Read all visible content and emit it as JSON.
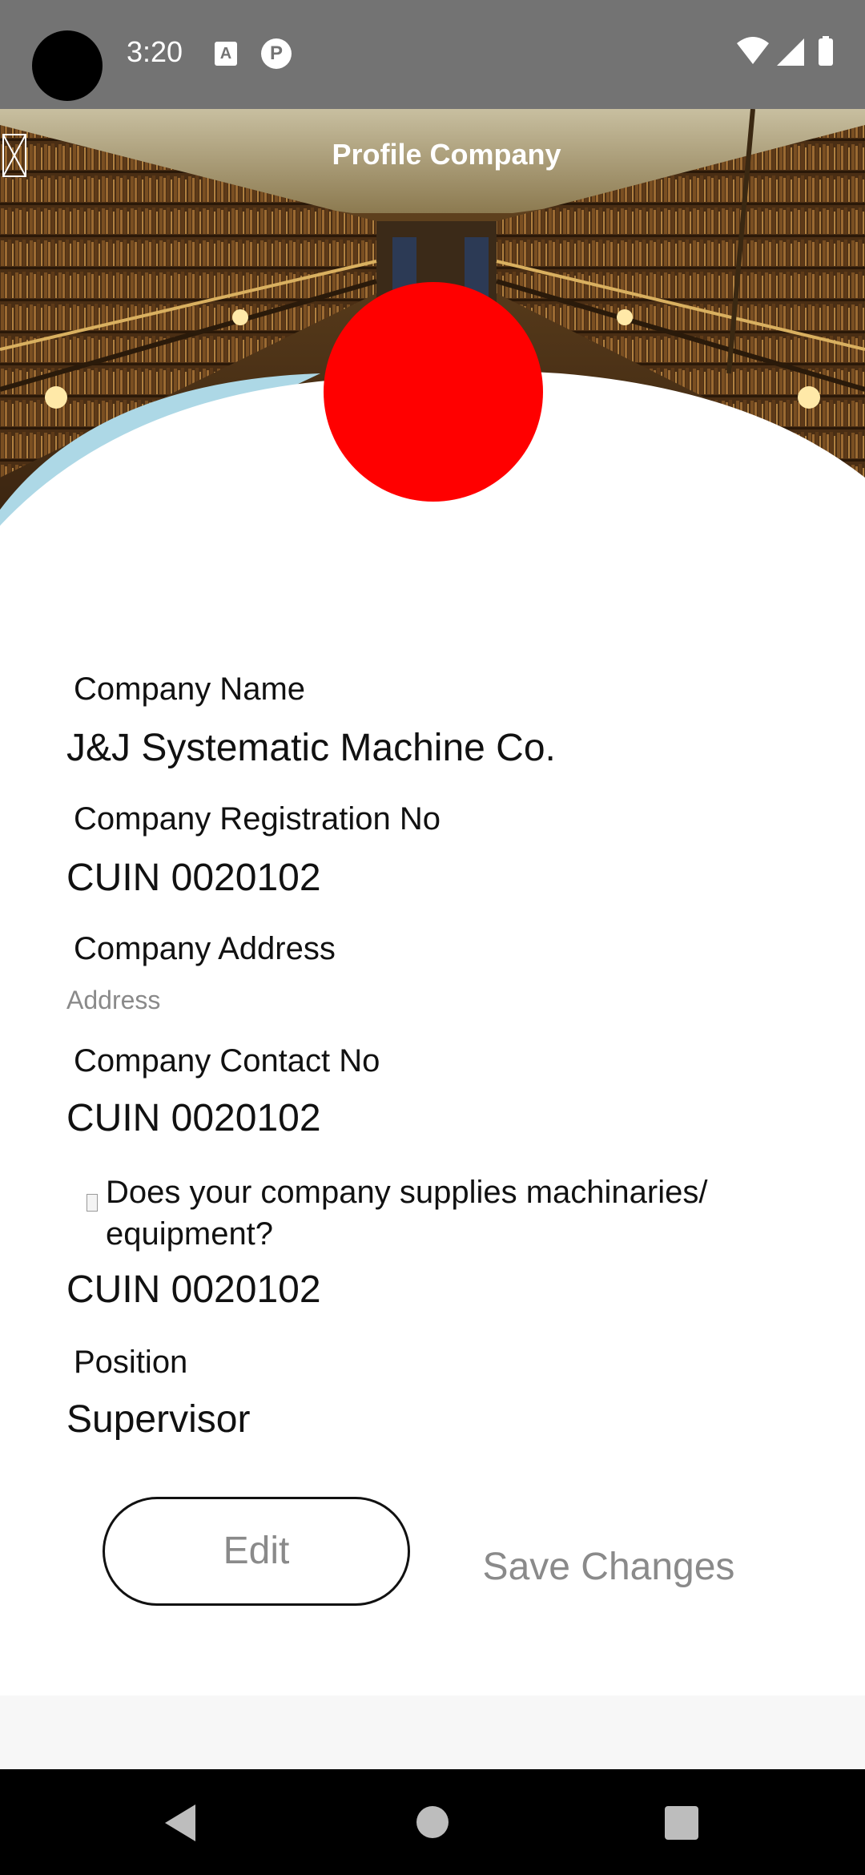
{
  "status_bar": {
    "time": "3:20",
    "icons": [
      "camera-cutout",
      "a-notification-icon",
      "p-notification-icon",
      "wifi-icon",
      "signal-icon",
      "battery-icon"
    ]
  },
  "header": {
    "title": "Profile Company",
    "back_icon": "back-icon",
    "background": "library-photo"
  },
  "avatar": {
    "color": "#ff0000"
  },
  "fields": [
    {
      "label": "Company Name",
      "value": "J&J Systematic Machine Co."
    },
    {
      "label": "Company Registration No",
      "value": "CUIN 0020102"
    },
    {
      "label": "Company Address",
      "placeholder": "Address"
    },
    {
      "label": "Company Contact No",
      "value": "CUIN 0020102"
    },
    {
      "label": "Does your company supplies machinaries/ equipment?",
      "value": "CUIN 0020102"
    },
    {
      "label": "Position",
      "value": "Supervisor"
    }
  ],
  "buttons": {
    "edit": "Edit",
    "save": "Save Changes"
  },
  "colors": {
    "status_bar": "#737373",
    "accent_wave": "#add8e6",
    "button_text": "#8a8a8a"
  }
}
